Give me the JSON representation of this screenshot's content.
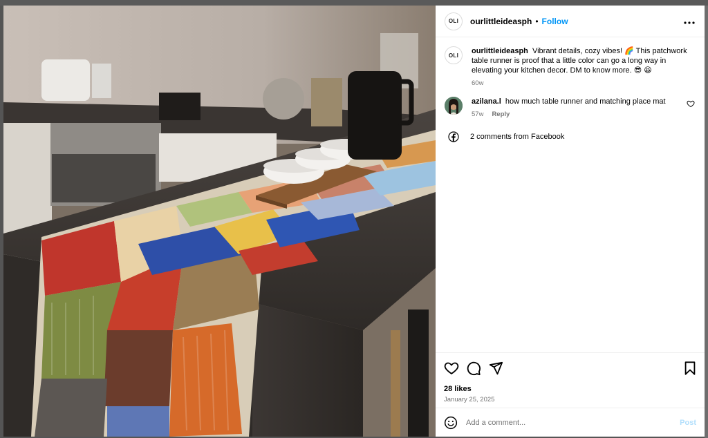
{
  "post": {
    "author": "ourlittleideasph",
    "author_avatar_text": "OLI",
    "follow_label": "Follow",
    "more_icon": "more-horizontal-icon",
    "separator": "•"
  },
  "caption": {
    "user": "ourlittleideasph",
    "text": "Vibrant details, cozy vibes! 🌈 This patchwork table runner is proof that a little color can go a long way in elevating your kitchen decor. DM to know more. 😎 😆",
    "time": "60w"
  },
  "comments": [
    {
      "user": "azilana.l",
      "text": "how much table runner and matching place mat",
      "time": "57w",
      "reply_label": "Reply"
    }
  ],
  "facebook": {
    "icon": "facebook-icon",
    "label": "2 comments from Facebook"
  },
  "actions": {
    "like_icon": "heart-icon",
    "comment_icon": "comment-icon",
    "share_icon": "share-icon",
    "save_icon": "bookmark-icon"
  },
  "likes_text": "28 likes",
  "date_text": "January 25, 2025",
  "composer": {
    "placeholder": "Add a comment...",
    "post_label": "Post",
    "emoji_icon": "emoji-icon"
  },
  "colors": {
    "follow_blue": "#0095f6",
    "post_disabled": "#b2dffc",
    "meta_gray": "#737373"
  }
}
